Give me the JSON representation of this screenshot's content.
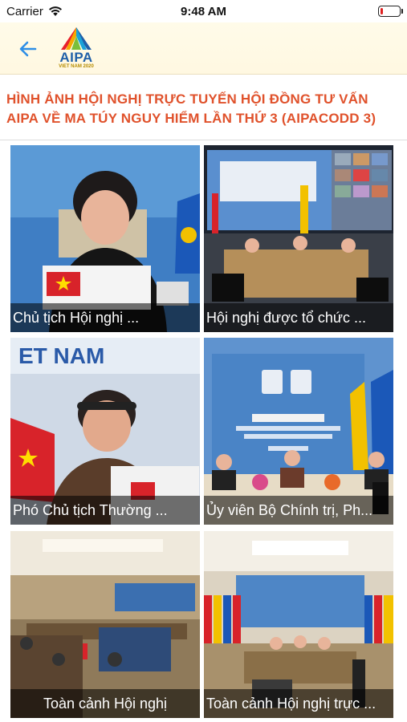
{
  "status": {
    "carrier": "Carrier",
    "time": "9:48 AM",
    "battery_level": 0.12
  },
  "nav": {
    "logo_text": "AIPA",
    "logo_sub": "VIET NAM 2020"
  },
  "title": "HÌNH ẢNH HỘI NGHỊ TRỰC TUYẾN HỘI ĐỒNG TƯ VẤN AIPA VỀ MA TÚY NGUY HIỂM LẦN THỨ 3 (AIPACODD 3)",
  "gallery": [
    {
      "caption": "Chủ tịch Hội nghị ..."
    },
    {
      "caption": "Hội nghị được tổ chức ..."
    },
    {
      "caption": "Phó Chủ tịch Thường ..."
    },
    {
      "caption": "Ủy viên Bộ Chính trị, Ph..."
    },
    {
      "caption": "Toàn cảnh Hội nghị"
    },
    {
      "caption": "Toàn cảnh Hội nghị trực ..."
    }
  ],
  "colors": {
    "title": "#e0522c",
    "back": "#2f8fe6",
    "logo": "#1f5fa8"
  }
}
